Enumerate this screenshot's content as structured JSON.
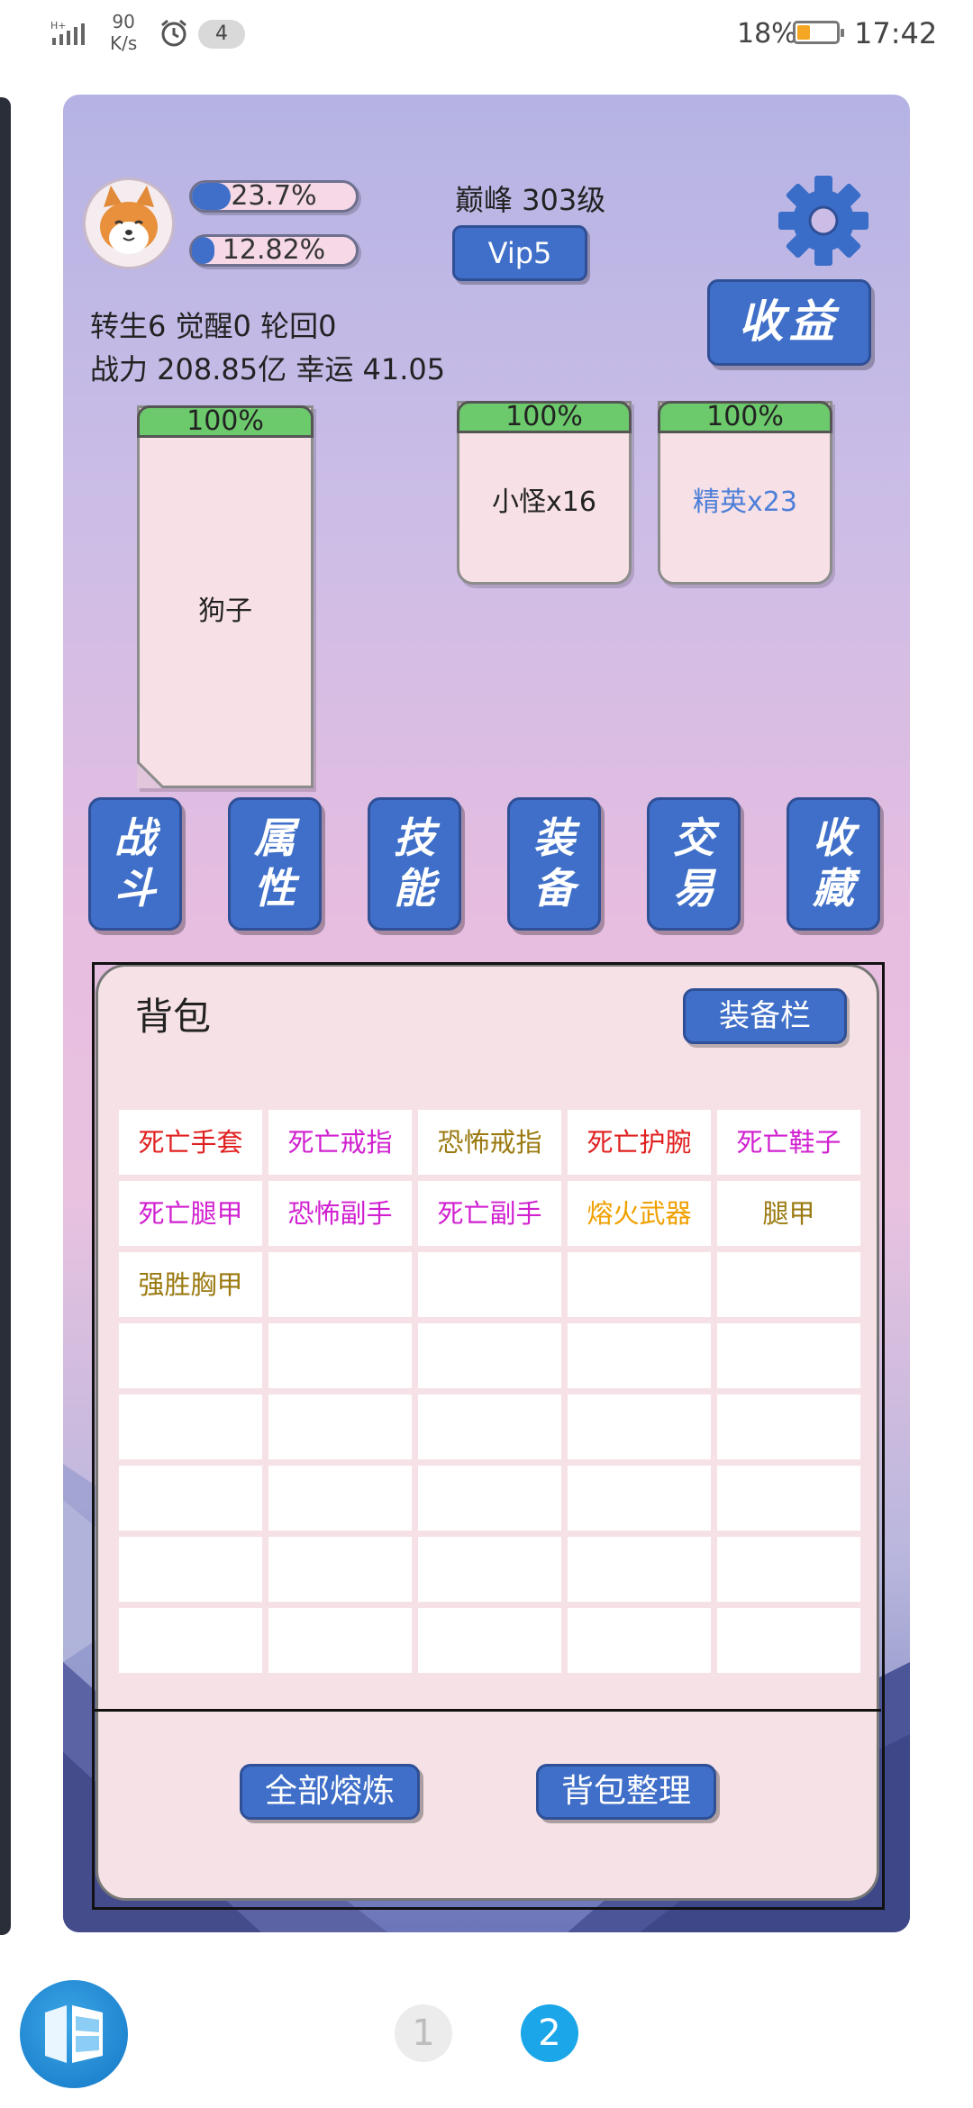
{
  "status_bar": {
    "network": "H+",
    "speed_value": "90",
    "speed_unit": "K/s",
    "notification_count": "4",
    "battery_percent": "18%",
    "battery_level": 0.18,
    "time": "17:42"
  },
  "player": {
    "exp_bar": {
      "text": "23.7%",
      "fraction": 0.237
    },
    "second_bar": {
      "text": "12.82%",
      "fraction": 0.1282
    },
    "level_text": "巅峰 303级",
    "vip_label": "Vip5",
    "reincarnation_line": "转生6 觉醒0 轮回0",
    "power_line": "战力 208.85亿  幸运 41.05"
  },
  "income_button": "收益",
  "enemies": {
    "boss": {
      "hp": "100%",
      "name": "狗子"
    },
    "minion": {
      "hp": "100%",
      "name": "小怪x16"
    },
    "elite": {
      "hp": "100%",
      "name": "精英x23"
    }
  },
  "tabs": [
    {
      "line1": "战",
      "line2": "斗"
    },
    {
      "line1": "属",
      "line2": "性"
    },
    {
      "line1": "技",
      "line2": "能"
    },
    {
      "line1": "装",
      "line2": "备"
    },
    {
      "line1": "交",
      "line2": "易"
    },
    {
      "line1": "收",
      "line2": "藏"
    }
  ],
  "backpack": {
    "title": "背包",
    "equip_bar_button": "装备栏",
    "items": [
      {
        "name": "死亡手套",
        "color": "#e02020"
      },
      {
        "name": "死亡戒指",
        "color": "#d020d0"
      },
      {
        "name": "恐怖戒指",
        "color": "#9a7a10"
      },
      {
        "name": "死亡护腕",
        "color": "#e02020"
      },
      {
        "name": "死亡鞋子",
        "color": "#d020d0"
      },
      {
        "name": "死亡腿甲",
        "color": "#d020d0"
      },
      {
        "name": "恐怖副手",
        "color": "#d020d0"
      },
      {
        "name": "死亡副手",
        "color": "#d020d0"
      },
      {
        "name": "熔火武器",
        "color": "#f0a000"
      },
      {
        "name": "腿甲",
        "color": "#9a7a10"
      },
      {
        "name": "强胜胸甲",
        "color": "#9a7a10"
      }
    ],
    "total_slots": 40,
    "smelt_all_button": "全部熔炼",
    "sort_button": "背包整理"
  },
  "pager": {
    "pages": [
      "1",
      "2"
    ],
    "active": "2"
  },
  "colors": {
    "button_blue": "#3f6fc8",
    "hp_green": "#6cc96c",
    "elite_text": "#4d7fd8",
    "active_dot": "#1aa6e8"
  }
}
